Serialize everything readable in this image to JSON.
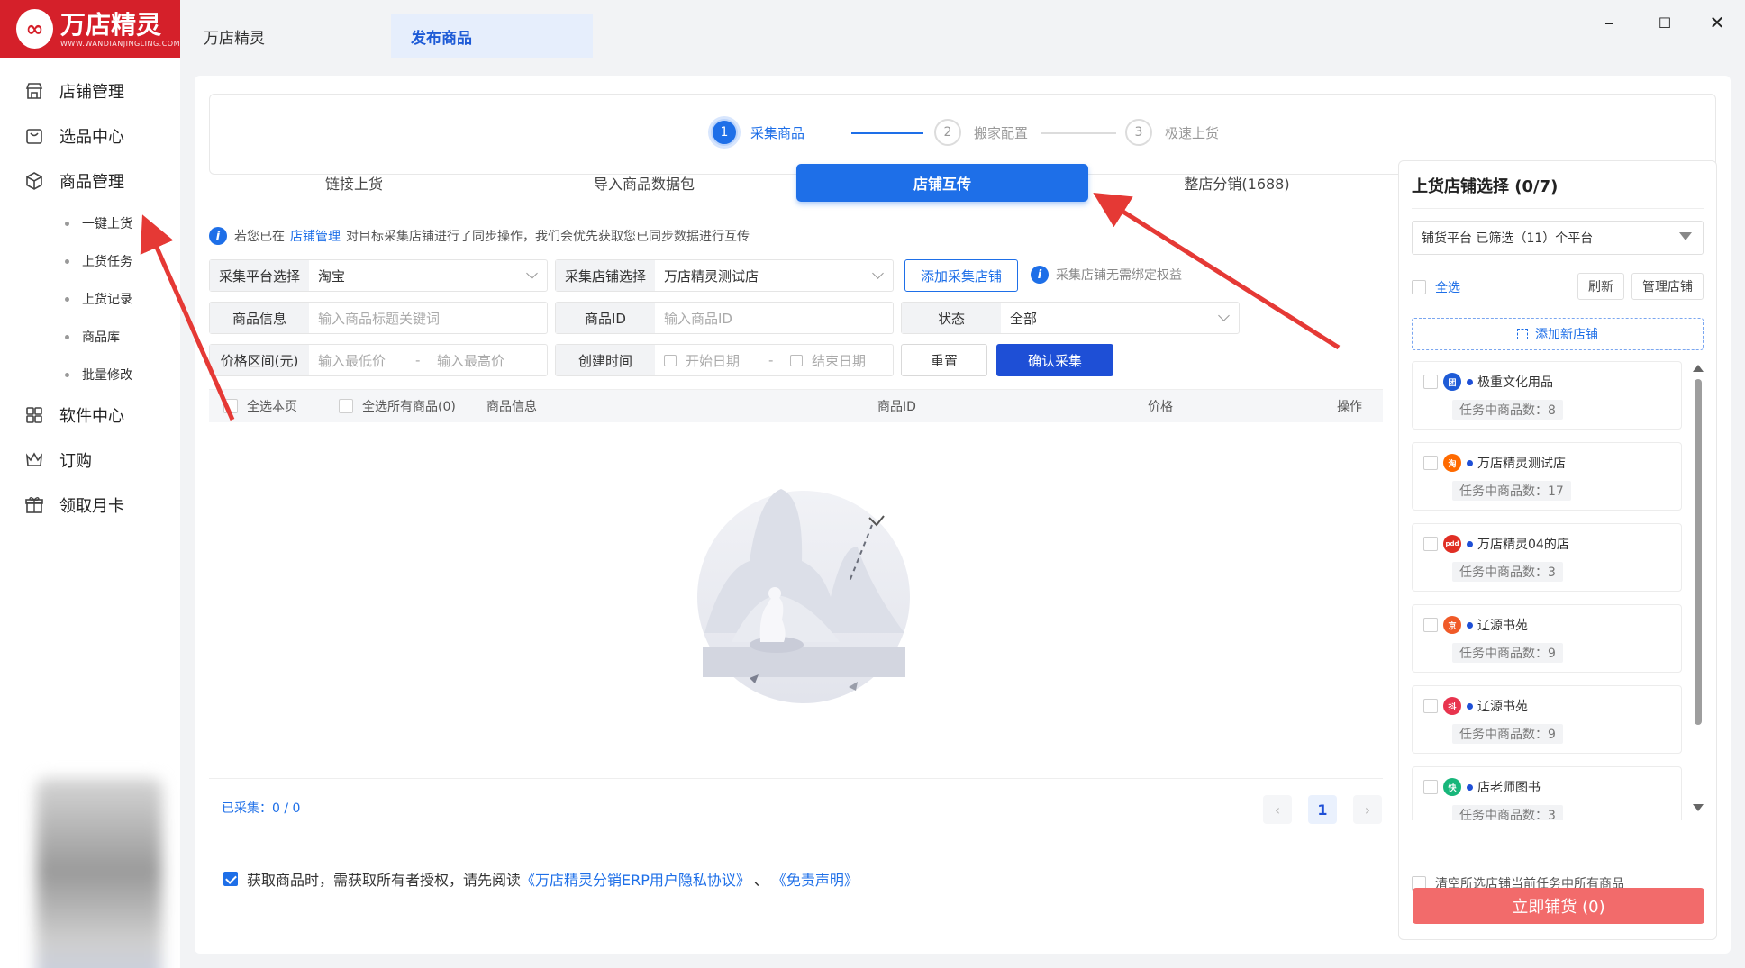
{
  "app": {
    "brand_cn": "万店精灵",
    "brand_en": "WWW.WANDIANJINGLING.COM",
    "tabs": [
      "万店精灵",
      "发布商品"
    ],
    "window_controls": {
      "minimize": "–",
      "maximize": "☐",
      "close": "✕"
    }
  },
  "sidebar": {
    "items": [
      "店铺管理",
      "选品中心",
      "商品管理"
    ],
    "sub_items": [
      "一键上货",
      "上货任务",
      "上货记录",
      "商品库",
      "批量修改"
    ],
    "bottom_items": [
      "软件中心",
      "订购",
      "领取月卡"
    ]
  },
  "steps": [
    {
      "num": "1",
      "label": "采集商品"
    },
    {
      "num": "2",
      "label": "搬家配置"
    },
    {
      "num": "3",
      "label": "极速上货"
    }
  ],
  "subtabs": [
    "链接上货",
    "导入商品数据包",
    "店铺互传",
    "整店分销(1688)"
  ],
  "notice": {
    "pre": "若您已在",
    "link": "店铺管理",
    "post": "对目标采集店铺进行了同步操作，我们会优先获取您已同步数据进行互传"
  },
  "filters": {
    "platform_label": "采集平台选择",
    "platform_value": "淘宝",
    "shop_label": "采集店铺选择",
    "shop_value": "万店精灵测试店",
    "add_shop_btn": "添加采集店铺",
    "bind_tip": "采集店铺无需绑定权益",
    "goods_info_label": "商品信息",
    "goods_info_ph": "输入商品标题关键词",
    "goods_id_label": "商品ID",
    "goods_id_ph": "输入商品ID",
    "status_label": "状态",
    "status_value": "全部",
    "price_label": "价格区间(元)",
    "price_min_ph": "输入最低价",
    "price_sep": "-",
    "price_max_ph": "输入最高价",
    "time_label": "创建时间",
    "start_ph": "开始日期",
    "time_sep": "-",
    "end_ph": "结束日期",
    "reset_btn": "重置",
    "confirm_btn": "确认采集"
  },
  "table": {
    "select_page": "全选本页",
    "select_all": "全选所有商品(0)",
    "col_info": "商品信息",
    "col_id": "商品ID",
    "col_price": "价格",
    "col_op": "操作"
  },
  "footer": {
    "collected": "已采集：0 / 0",
    "page": "1",
    "prev": "‹",
    "next": "›"
  },
  "agreement": {
    "pre": "获取商品时，需获取所有者授权，请先阅读",
    "link1": "《万店精灵分销ERP用户隐私协议》",
    "sep": "、",
    "link2": "《免责声明》"
  },
  "right_panel": {
    "title": "上货店铺选择 (0/7)",
    "filter_text": "铺货平台  已筛选（11）个平台",
    "select_all": "全选",
    "refresh": "刷新",
    "manage": "管理店铺",
    "add_shop": "添加新店铺",
    "shops": [
      {
        "name": "极重文化用品",
        "count": "任务中商品数：8",
        "icon_text": "团",
        "icon_color": "#1e5bd6"
      },
      {
        "name": "万店精灵测试店",
        "count": "任务中商品数：17",
        "icon_text": "淘",
        "icon_color": "#ff6a00"
      },
      {
        "name": "万店精灵04的店",
        "count": "任务中商品数：3",
        "icon_text": "pdd",
        "icon_color": "#e02e24"
      },
      {
        "name": "辽源书苑",
        "count": "任务中商品数：9",
        "icon_text": "京",
        "icon_color": "#f05a28"
      },
      {
        "name": "辽源书苑",
        "count": "任务中商品数：9",
        "icon_text": "抖",
        "icon_color": "#e8344e"
      },
      {
        "name": "店老师图书",
        "count": "任务中商品数：3",
        "icon_text": "快",
        "icon_color": "#17b67a"
      }
    ],
    "clear_text": "清空所选店铺当前任务中所有商品",
    "submit": "立即铺货 (0)"
  },
  "colors": {
    "primary": "#1e6fe8",
    "brand_red": "#d5202a",
    "submit_red": "#f26b6b",
    "arrow_red": "#e53935"
  }
}
